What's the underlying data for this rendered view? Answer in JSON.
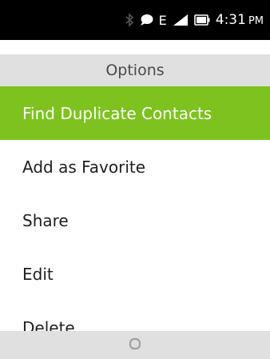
{
  "status_bar": {
    "icons": [
      "bluetooth-icon",
      "message-icon",
      "signal-icon",
      "battery-icon"
    ],
    "network": "E",
    "time": "4:31",
    "ampm": "PM"
  },
  "header": {
    "title": "Options"
  },
  "menu": {
    "items": [
      {
        "label": "Find Duplicate Contacts",
        "selected": true
      },
      {
        "label": "Add as Favorite",
        "selected": false
      },
      {
        "label": "Share",
        "selected": false
      },
      {
        "label": "Edit",
        "selected": false
      },
      {
        "label": "Delete",
        "selected": false
      }
    ]
  },
  "softkeys": {
    "center_icon": "circle-select-icon"
  },
  "colors": {
    "accent": "#7dc21e",
    "header_bg": "#e0e0e0",
    "status_bg": "#000000"
  }
}
